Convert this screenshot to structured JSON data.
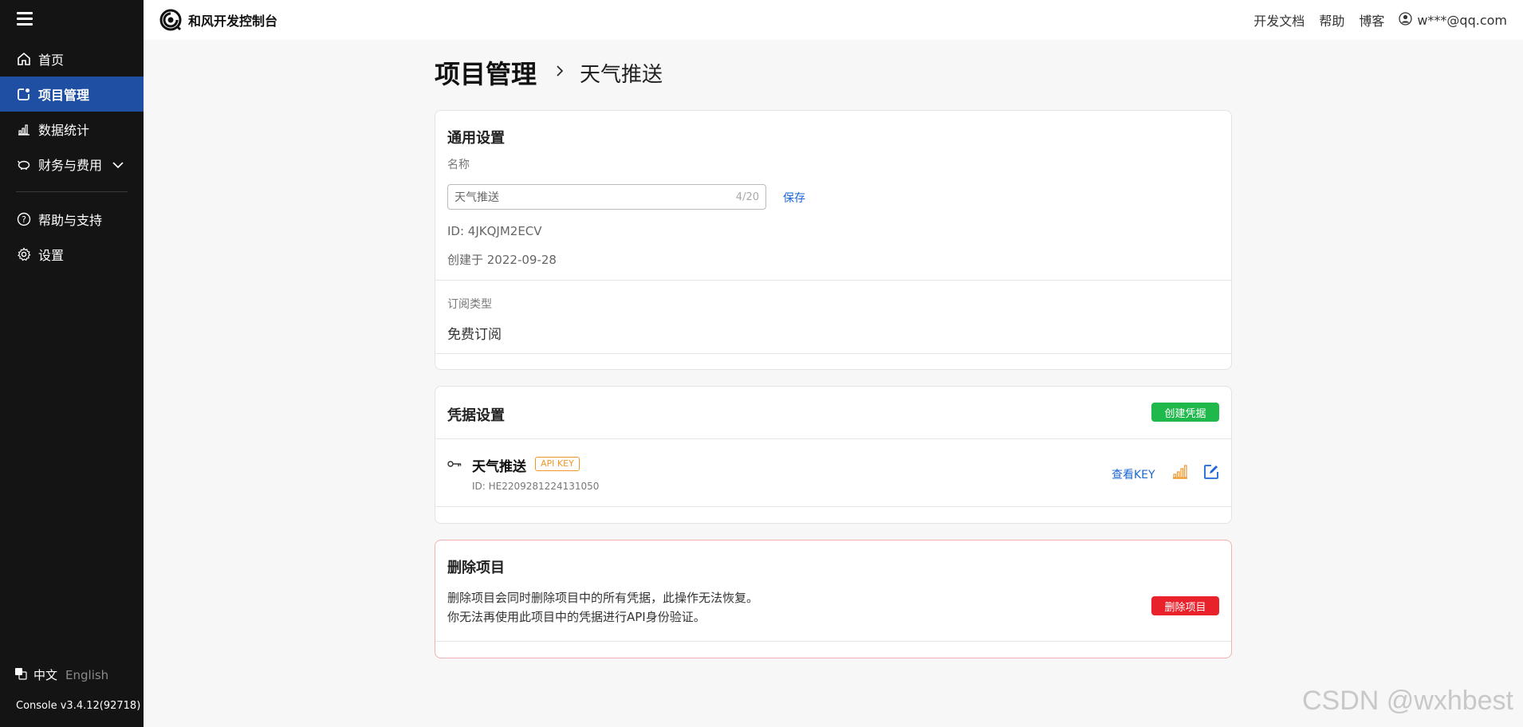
{
  "sidebar": {
    "items": [
      {
        "label": "首页",
        "icon": "home-icon"
      },
      {
        "label": "项目管理",
        "icon": "project-icon",
        "active": true
      },
      {
        "label": "数据统计",
        "icon": "bar-chart-icon"
      },
      {
        "label": "财务与费用",
        "icon": "piggy-bank-icon"
      },
      {
        "label": "帮助与支持",
        "icon": "help-icon"
      },
      {
        "label": "设置",
        "icon": "gear-icon"
      }
    ],
    "lang_zh": "中文",
    "lang_en": "English",
    "version": "Console v3.4.12(92718)"
  },
  "topbar": {
    "brand": "和风开发控制台",
    "links": [
      "开发文档",
      "帮助",
      "博客"
    ],
    "user": "w***@qq.com"
  },
  "page": {
    "title": "项目管理",
    "subtitle": "天气推送"
  },
  "general": {
    "title": "通用设置",
    "name_label": "名称",
    "name_value": "天气推送",
    "name_count": "4/20",
    "save_label": "保存",
    "id_text": "ID: 4JKQJM2ECV",
    "created_text": "创建于 2022-09-28",
    "sub_type_label": "订阅类型",
    "sub_type_value": "免费订阅"
  },
  "credentials": {
    "title": "凭据设置",
    "create_label": "创建凭据",
    "items": [
      {
        "name": "天气推送",
        "badge": "API KEY",
        "id": "ID: HE2209281224131050",
        "view_key": "查看KEY"
      }
    ]
  },
  "delete": {
    "title": "删除项目",
    "line1": "删除项目会同时删除项目中的所有凭据，此操作无法恢复。",
    "line2": "你无法再使用此项目中的凭据进行API身份验证。",
    "button": "删除项目"
  },
  "watermark": "CSDN @wxhbest",
  "colors": {
    "sidebar_bg": "#141414",
    "active_bg": "#1f4fa3",
    "link": "#1a66d6",
    "green": "#1fb84b",
    "red": "#e8212b",
    "badge": "#f0962b"
  }
}
